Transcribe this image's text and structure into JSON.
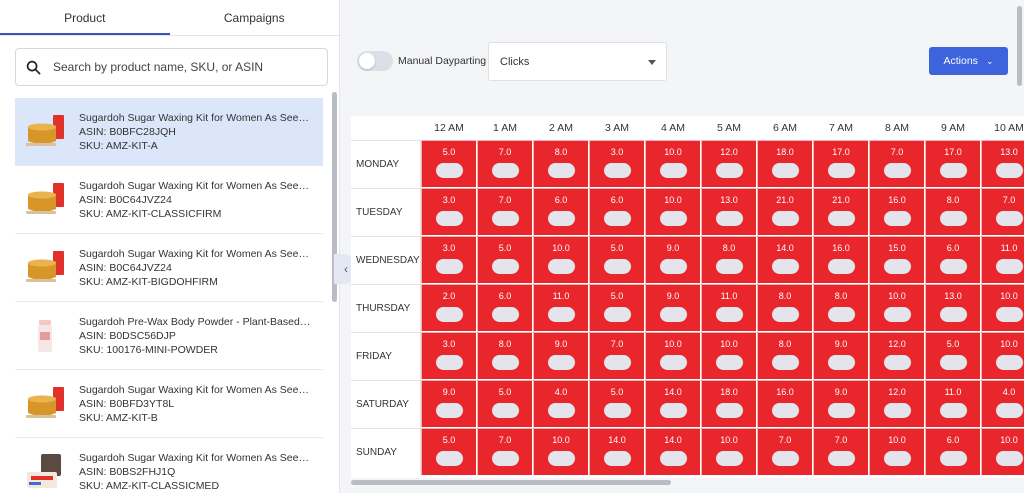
{
  "tabs": [
    "Product",
    "Campaigns"
  ],
  "search": {
    "placeholder": "Search by product name, SKU, or ASIN"
  },
  "products": [
    {
      "name": "Sugardoh Sugar Waxing Kit for Women As Seen on Shark Tank",
      "asin": "ASIN: B0BFC28JQH",
      "sku": "SKU: AMZ-KIT-A",
      "icon": "wax-jar-icon"
    },
    {
      "name": "Sugardoh Sugar Waxing Kit for Women As Seen on Shark Tank",
      "asin": "ASIN: B0C64JVZ24",
      "sku": "SKU: AMZ-KIT-CLASSICFIRM",
      "icon": "wax-jar-icon"
    },
    {
      "name": "Sugardoh Sugar Waxing Kit for Women As Seen on Shark Tank",
      "asin": "ASIN: B0C64JVZ24",
      "sku": "SKU: AMZ-KIT-BIGDOHFIRM",
      "icon": "wax-jar-icon"
    },
    {
      "name": "Sugardoh Pre-Wax Body Powder - Plant-Based Formula",
      "asin": "ASIN: B0DSC56DJP",
      "sku": "SKU: 100176-MINI-POWDER",
      "icon": "powder-bottle-icon"
    },
    {
      "name": "Sugardoh Sugar Waxing Kit for Women As Seen on Shark Tank",
      "asin": "ASIN: B0BFD3YT8L",
      "sku": "SKU: AMZ-KIT-B",
      "icon": "wax-jar-icon"
    },
    {
      "name": "Sugardoh Sugar Waxing Kit for Women As Seen on Shark Tank",
      "asin": "ASIN: B0BS2FHJ1Q",
      "sku": "SKU: AMZ-KIT-CLASSICMED",
      "icon": "wax-kit-icon"
    }
  ],
  "toolbar": {
    "toggle_label": "Manual Dayparting",
    "metric_selected": "Clicks",
    "actions_label": "Actions"
  },
  "grid": {
    "hours": [
      "12 AM",
      "1 AM",
      "2 AM",
      "3 AM",
      "4 AM",
      "5 AM",
      "6 AM",
      "7 AM",
      "8 AM",
      "9 AM",
      "10 AM"
    ],
    "rows": [
      {
        "day": "MONDAY",
        "values": [
          "5.0",
          "7.0",
          "8.0",
          "3.0",
          "10.0",
          "12.0",
          "18.0",
          "17.0",
          "7.0",
          "17.0",
          "13.0"
        ]
      },
      {
        "day": "TUESDAY",
        "values": [
          "3.0",
          "7.0",
          "6.0",
          "6.0",
          "10.0",
          "13.0",
          "21.0",
          "21.0",
          "16.0",
          "8.0",
          "7.0"
        ]
      },
      {
        "day": "WEDNESDAY",
        "values": [
          "3.0",
          "5.0",
          "10.0",
          "5.0",
          "9.0",
          "8.0",
          "14.0",
          "16.0",
          "15.0",
          "6.0",
          "11.0"
        ]
      },
      {
        "day": "THURSDAY",
        "values": [
          "2.0",
          "6.0",
          "11.0",
          "5.0",
          "9.0",
          "11.0",
          "8.0",
          "8.0",
          "10.0",
          "13.0",
          "10.0"
        ]
      },
      {
        "day": "FRIDAY",
        "values": [
          "3.0",
          "8.0",
          "9.0",
          "7.0",
          "10.0",
          "10.0",
          "8.0",
          "9.0",
          "12.0",
          "5.0",
          "10.0"
        ]
      },
      {
        "day": "SATURDAY",
        "values": [
          "9.0",
          "5.0",
          "4.0",
          "5.0",
          "14.0",
          "18.0",
          "16.0",
          "9.0",
          "12.0",
          "11.0",
          "4.0"
        ]
      },
      {
        "day": "SUNDAY",
        "values": [
          "5.0",
          "7.0",
          "10.0",
          "14.0",
          "14.0",
          "10.0",
          "7.0",
          "7.0",
          "10.0",
          "6.0",
          "10.0"
        ]
      }
    ]
  },
  "colors": {
    "cell_active": "#e8262c",
    "accent": "#3d63dd",
    "selected_row": "#dbe6fb"
  }
}
